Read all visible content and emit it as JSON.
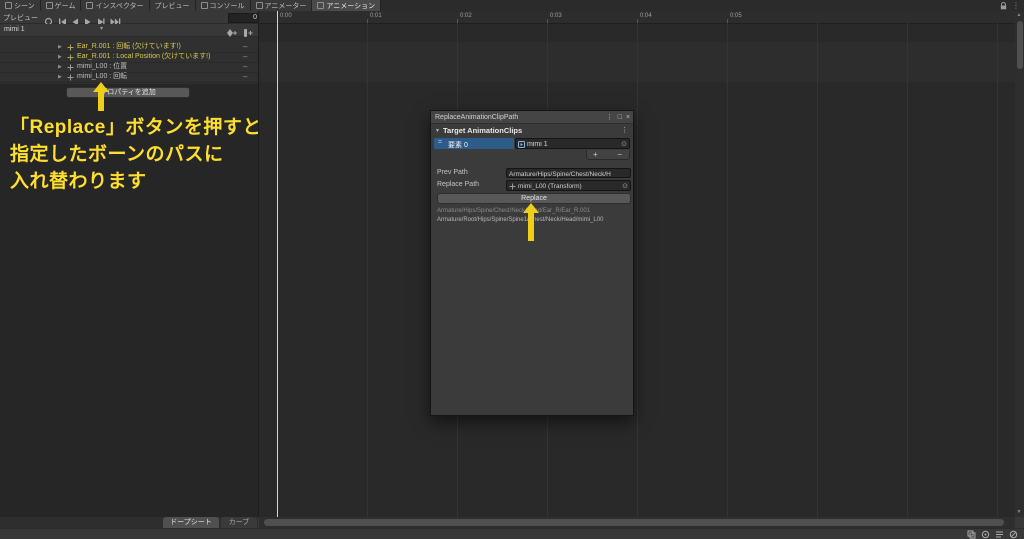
{
  "tabs": {
    "items": [
      {
        "label": "シーン"
      },
      {
        "label": "ゲーム"
      },
      {
        "label": "インスペクター"
      },
      {
        "label": "プレビュー"
      },
      {
        "label": "コンソール"
      },
      {
        "label": "アニメーター"
      },
      {
        "label": "アニメーション"
      }
    ]
  },
  "toolbar": {
    "preview": "プレビュー",
    "frame": "0"
  },
  "clip": {
    "name": "mimi 1"
  },
  "ruler": {
    "ticks": [
      "0:00",
      "0:01",
      "0:02",
      "0:03",
      "0:04",
      "0:05"
    ]
  },
  "properties": {
    "rows": [
      {
        "label": "Ear_R.001 : 回転 (欠けています!)"
      },
      {
        "label": "Ear_R.001 : Local Position (欠けています!)"
      },
      {
        "label": "mimi_L00 : 位置"
      },
      {
        "label": "mimi_L00 : 回転"
      }
    ],
    "add_button": "プロパティを追加"
  },
  "annotation": {
    "line1": "「Replace」ボタンを押すと",
    "line2": "指定したボーンのパスに",
    "line3": "入れ替わります"
  },
  "dialog": {
    "title": "ReplaceAnimationClipPath",
    "section": "Target AnimationClips",
    "element_label": "要素 0",
    "element_value": "mimi 1",
    "add_label": "+",
    "remove_label": "−",
    "prev_path_label": "Prev Path",
    "prev_path_value": "Armature/Hips/Spine/Chest/Neck/H",
    "replace_path_label": "Replace Path",
    "replace_path_value": "mimi_L00 (Transform)",
    "replace_button": "Replace",
    "result_path_old": "Armature/Hips/Spine/Chest/Neck/Head/Ear_R/Ear_R.001",
    "result_path_new": "Armature/Root/Hips/Spine/Spine1/Chest/Neck/Head/mimi_L00"
  },
  "bottom_tabs": {
    "dopesheet": "ドープシート",
    "curves": "カーブ"
  },
  "icons": {
    "kebab": "⋮",
    "maximize": "□",
    "close": "×",
    "caret_down": "▾",
    "disclosure": "▶",
    "fold_open": "▼",
    "target_picker": "⊙",
    "row_menu": "–",
    "drag_handle": "=",
    "scroll_up": "▲",
    "scroll_down": "▼"
  },
  "colors": {
    "annotation_yellow": "#FFDF2E",
    "arrow_yellow": "#EFCE1A",
    "selection_blue": "#2E5C8A",
    "missing_property_yellow": "#D8C64F"
  }
}
